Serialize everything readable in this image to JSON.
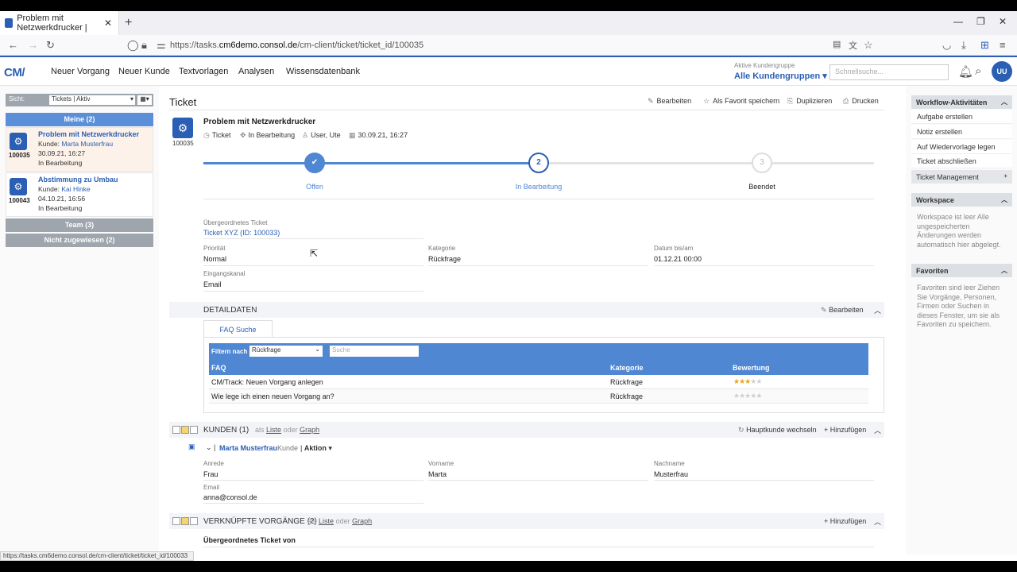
{
  "browser": {
    "tab_title": "Problem mit Netzwerkdrucker |",
    "url_prefix": "https://tasks.",
    "url_domain": "cm6demo.consol.de",
    "url_path": "/cm-client/ticket/ticket_id/100035",
    "status_url": "https://tasks.cm6demo.consol.de/cm-client/ticket/ticket_id/100033"
  },
  "header": {
    "logo": "CM/",
    "menu": [
      "Neuer Vorgang",
      "Neuer Kunde",
      "Textvorlagen",
      "Analysen",
      "Wissensdatenbank"
    ],
    "kundengruppe_label": "Aktive Kundengruppe",
    "kundengruppe_value": "Alle Kundengruppen",
    "quicksearch_placeholder": "Schnellsuche...",
    "avatar": "UU"
  },
  "left": {
    "view_label": "Sicht:",
    "view_value": "Tickets | Aktiv",
    "groups": {
      "mine": "Meine (2)",
      "team": "Team (3)",
      "none": "Nicht zugewiesen (2)"
    },
    "tickets": [
      {
        "id": "100035",
        "title": "Problem mit Netzwerkdrucker",
        "kunde_label": "Kunde:",
        "kunde": "Marta Musterfrau",
        "date": "30.09.21, 16:27",
        "status": "In Bearbeitung"
      },
      {
        "id": "100043",
        "title": "Abstimmung zu Umbau",
        "kunde_label": "Kunde:",
        "kunde": "Kai Hinke",
        "date": "04.10.21, 16:56",
        "status": "In Bearbeitung"
      }
    ]
  },
  "main": {
    "title": "Ticket",
    "actions": {
      "edit": "Bearbeiten",
      "favorite": "Als Favorit speichern",
      "duplicate": "Duplizieren",
      "print": "Drucken"
    },
    "ticket": {
      "id": "100035",
      "title": "Problem mit Netzwerkdrucker",
      "type": "Ticket",
      "status": "In Bearbeitung",
      "user": "User, Ute",
      "date": "30.09.21, 16:27"
    },
    "steps": [
      {
        "label": "Offen",
        "mark": "✔"
      },
      {
        "label": "In Bearbeitung",
        "mark": "2"
      },
      {
        "label": "Beendet",
        "mark": "3"
      }
    ],
    "fields": {
      "parent_label": "Übergeordnetes Ticket",
      "parent_value": "Ticket XYZ (ID: 100033)",
      "prio_label": "Priorität",
      "prio_value": "Normal",
      "kat_label": "Kategorie",
      "kat_value": "Rückfrage",
      "due_label": "Datum bis/am",
      "due_value": "01.12.21 00:00",
      "channel_label": "Eingangskanal",
      "channel_value": "Email"
    },
    "detail": {
      "title": "DETAILDATEN",
      "edit": "Bearbeiten",
      "faq_tab": "FAQ Suche",
      "filter_label": "Filtern nach",
      "filter_value": "Rückfrage",
      "search_placeholder": "Suche",
      "columns": [
        "FAQ",
        "Kategorie",
        "Bewertung"
      ],
      "rows": [
        {
          "faq": "CM/Track: Neuen Vorgang anlegen",
          "kategorie": "Rückfrage",
          "rating": 3
        },
        {
          "faq": "Wie lege ich einen neuen Vorgang an?",
          "kategorie": "Rückfrage",
          "rating": 0
        }
      ]
    },
    "kunden": {
      "title": "KUNDEN (1)",
      "als": "als",
      "liste": "Liste",
      "oder": "oder",
      "graph": "Graph",
      "switch": "Hauptkunde wechseln",
      "add": "Hinzufügen",
      "name": "Marta Musterfrau",
      "role": "Kunde",
      "aktion": "Aktion",
      "anrede_label": "Anrede",
      "anrede": "Frau",
      "vorname_label": "Vorname",
      "vorname": "Marta",
      "nachname_label": "Nachname",
      "nachname": "Musterfrau",
      "email_label": "Email",
      "email": "anna@consol.de"
    },
    "vorgaenge": {
      "title": "VERKNÜPFTE VORGÄNGE (2)",
      "als": "als",
      "liste": "Liste",
      "oder": "oder",
      "graph": "Graph",
      "add": "Hinzufügen",
      "sub": "Übergeordnetes Ticket von"
    }
  },
  "right": {
    "workflow_title": "Workflow-Aktivitäten",
    "workflow_items": [
      "Aufgabe erstellen",
      "Notiz erstellen",
      "Auf Wiedervorlage legen",
      "Ticket abschließen"
    ],
    "ticket_mgmt": "Ticket Management",
    "workspace_title": "Workspace",
    "workspace_text": "Workspace ist leer Alle ungespeicherten Änderungen werden automatisch hier abgelegt.",
    "favoriten_title": "Favoriten",
    "favoriten_text": "Favoriten sind leer Ziehen Sie Vorgänge, Personen, Firmen oder Suchen in dieses Fenster, um sie als Favoriten zu speichern."
  },
  "colors": {
    "accent": "#2b5fb4",
    "group_active": "#5b8fd8",
    "group_inactive": "#9ea5ad",
    "star": "#e6a817"
  }
}
